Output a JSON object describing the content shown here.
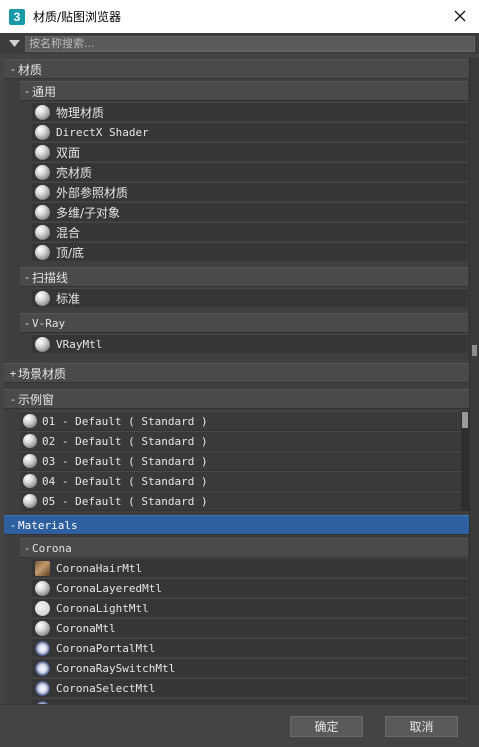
{
  "window": {
    "title": "材质/贴图浏览器",
    "app_icon_text": "3"
  },
  "search": {
    "placeholder": "按名称搜索..."
  },
  "groups": {
    "materials_cn": {
      "sign": "-",
      "label": "材质"
    },
    "general": {
      "sign": "-",
      "label": "通用"
    },
    "scanline": {
      "sign": "-",
      "label": "扫描线"
    },
    "vray": {
      "sign": "-",
      "label": "V-Ray"
    },
    "scene_materials": {
      "sign": "+",
      "label": "场景材质"
    },
    "sample_slots": {
      "sign": "-",
      "label": "示例窗"
    },
    "materials_en": {
      "sign": "-",
      "label": "Materials"
    },
    "corona": {
      "sign": "-",
      "label": "Corona"
    }
  },
  "general_items": [
    {
      "label": "物理材质",
      "icon": "sphere-icon"
    },
    {
      "label": "DirectX Shader",
      "icon": "sphere-icon"
    },
    {
      "label": "双面",
      "icon": "sphere-icon"
    },
    {
      "label": "壳材质",
      "icon": "sphere-icon"
    },
    {
      "label": "外部参照材质",
      "icon": "sphere-icon"
    },
    {
      "label": "多维/子对象",
      "icon": "sphere-icon"
    },
    {
      "label": "混合",
      "icon": "sphere-icon"
    },
    {
      "label": "顶/底",
      "icon": "sphere-icon"
    }
  ],
  "scanline_items": [
    {
      "label": "标准",
      "icon": "sphere-icon"
    }
  ],
  "vray_items": [
    {
      "label": "VRayMtl",
      "icon": "sphere-icon"
    }
  ],
  "sample_items": [
    {
      "label": "01 - Default  ( Standard )"
    },
    {
      "label": "02 - Default  ( Standard )"
    },
    {
      "label": "03 - Default  ( Standard )"
    },
    {
      "label": "04 - Default  ( Standard )"
    },
    {
      "label": "05 - Default  ( Standard )"
    }
  ],
  "corona_items": [
    {
      "label": "CoronaHairMtl",
      "icon": "hair-icon"
    },
    {
      "label": "CoronaLayeredMtl",
      "icon": "sphere-icon"
    },
    {
      "label": "CoronaLightMtl",
      "icon": "light-sphere-icon"
    },
    {
      "label": "CoronaMtl",
      "icon": "sphere-icon"
    },
    {
      "label": "CoronaPortalMtl",
      "icon": "portal-icon"
    },
    {
      "label": "CoronaRaySwitchMtl",
      "icon": "portal-icon"
    },
    {
      "label": "CoronaSelectMtl",
      "icon": "portal-icon"
    }
  ],
  "footer": {
    "ok_label": "确定",
    "cancel_label": "取消"
  },
  "colors": {
    "background": "#444444",
    "selected_header": "#2e5f9e",
    "title_bar": "#ffffff"
  }
}
